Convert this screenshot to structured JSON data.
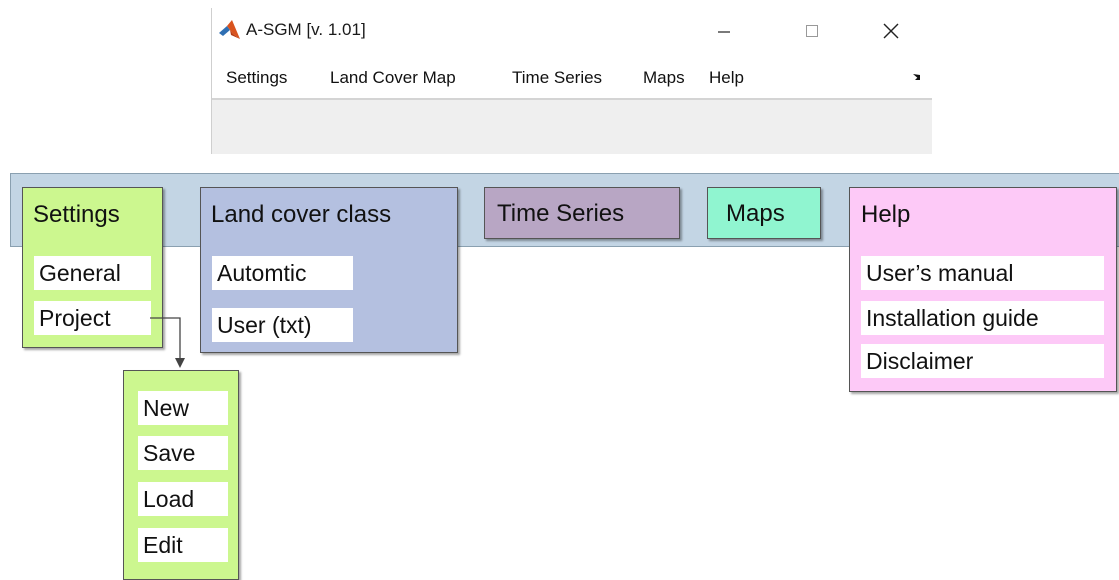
{
  "window": {
    "title": "A-SGM [v. 1.01]",
    "menu": [
      "Settings",
      "Land Cover Map",
      "Time Series",
      "Maps",
      "Help"
    ],
    "controls": {
      "minimize": "minimize",
      "maximize": "maximize",
      "close": "close"
    }
  },
  "diagram": {
    "settings": {
      "header": "Settings",
      "items": [
        "General",
        "Project"
      ]
    },
    "land_cover": {
      "header": "Land cover class",
      "items": [
        "Automtic",
        "User (txt)"
      ]
    },
    "time_series": {
      "header": "Time Series"
    },
    "maps": {
      "header": "Maps"
    },
    "help": {
      "header": "Help",
      "items": [
        "User’s manual",
        "Installation guide",
        "Disclaimer"
      ]
    },
    "project_submenu": {
      "items": [
        "New",
        "Save",
        "Load",
        "Edit"
      ]
    }
  },
  "colors": {
    "strip": "#c3d5e4",
    "settings": "#ccf78f",
    "land_cover": "#b4c0e0",
    "time_series": "#b8a6c4",
    "maps": "#90f5d0",
    "help": "#fdc9f7"
  },
  "icons": [
    "matlab-logo-icon",
    "minimize-icon",
    "maximize-icon",
    "close-icon",
    "undock-arrow-icon",
    "connector-arrow-icon"
  ]
}
